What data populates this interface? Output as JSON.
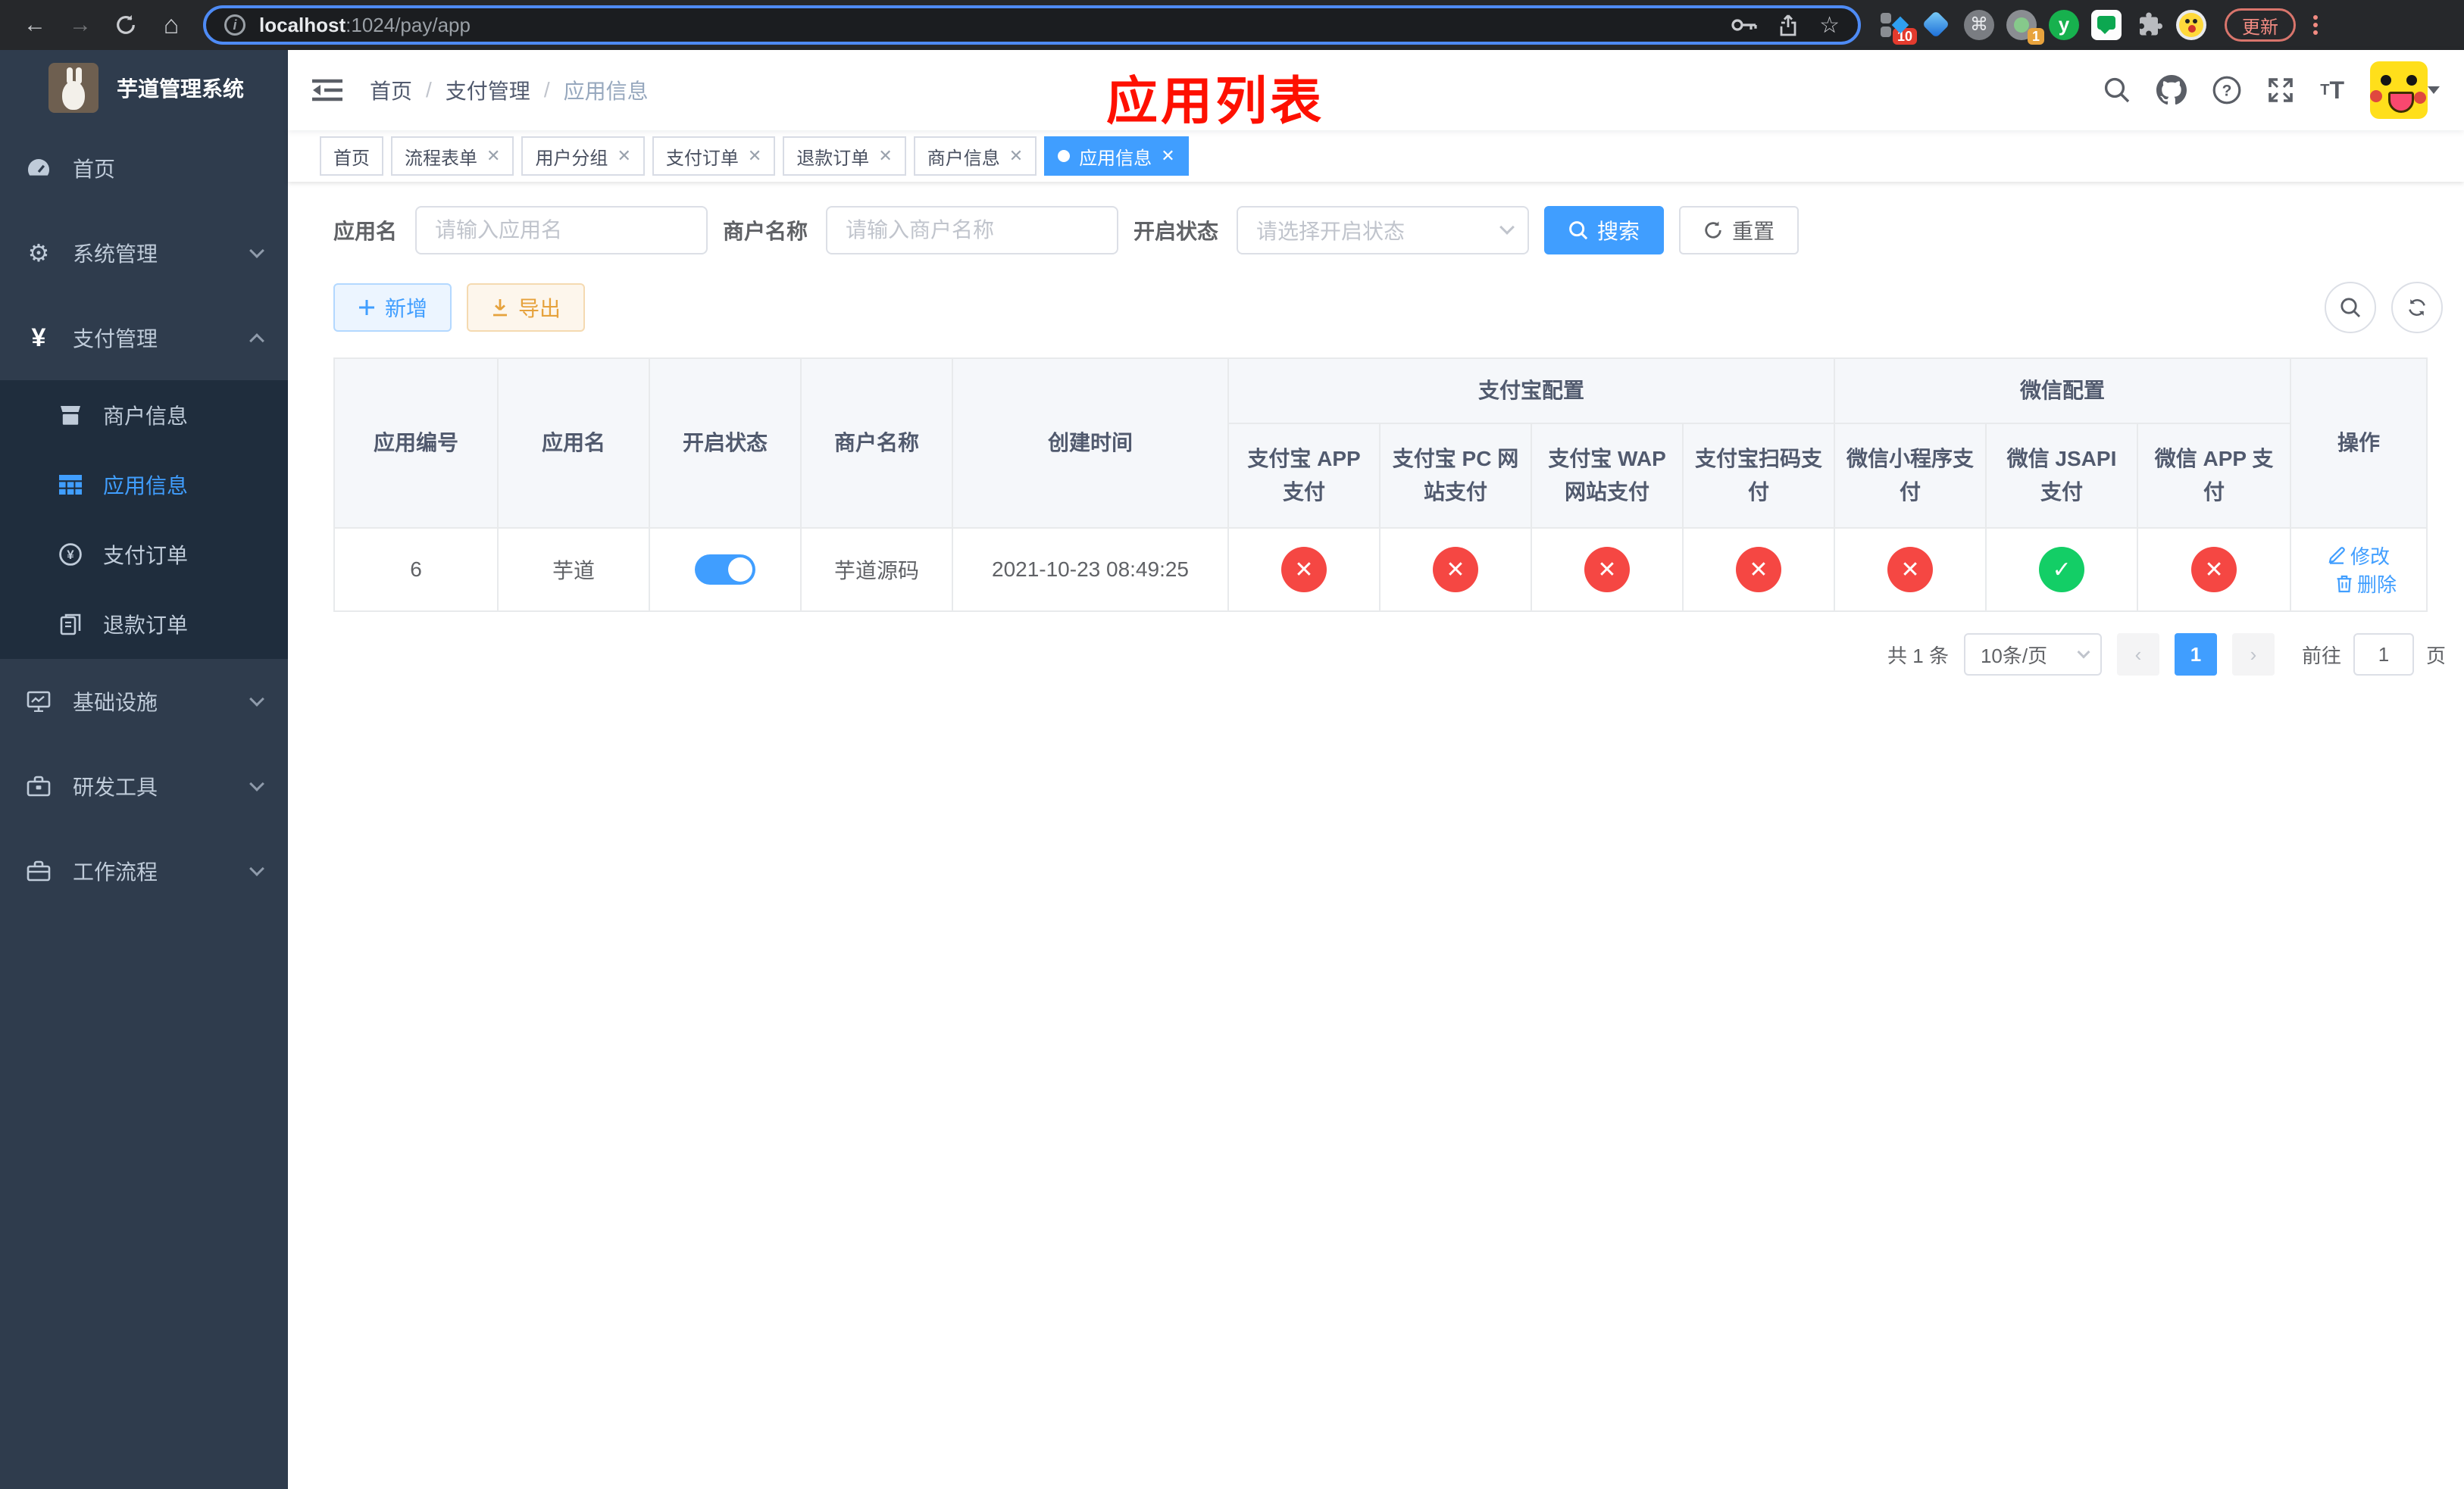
{
  "browser": {
    "url_host": "localhost",
    "url_rest": ":1024/pay/app",
    "update_label": "更新",
    "ext_badge_1": "10",
    "ext_badge_2": "1",
    "cmd_glyph": "⌘",
    "y_glyph": "y"
  },
  "sidebar": {
    "title": "芋道管理系统",
    "items": [
      {
        "label": "首页"
      },
      {
        "label": "系统管理"
      },
      {
        "label": "支付管理"
      },
      {
        "label": "基础设施"
      },
      {
        "label": "研发工具"
      },
      {
        "label": "工作流程"
      }
    ],
    "sub_items": [
      {
        "label": "商户信息"
      },
      {
        "label": "应用信息"
      },
      {
        "label": "支付订单"
      },
      {
        "label": "退款订单"
      }
    ]
  },
  "navbar": {
    "breadcrumb": [
      "首页",
      "支付管理",
      "应用信息"
    ],
    "annotation": "应用列表"
  },
  "tags": [
    {
      "label": "首页"
    },
    {
      "label": "流程表单"
    },
    {
      "label": "用户分组"
    },
    {
      "label": "支付订单"
    },
    {
      "label": "退款订单"
    },
    {
      "label": "商户信息"
    },
    {
      "label": "应用信息"
    }
  ],
  "filters": {
    "app_name_label": "应用名",
    "app_name_placeholder": "请输入应用名",
    "merchant_label": "商户名称",
    "merchant_placeholder": "请输入商户名称",
    "status_label": "开启状态",
    "status_placeholder": "请选择开启状态",
    "search_label": "搜索",
    "reset_label": "重置"
  },
  "toolbar": {
    "add_label": "新增",
    "export_label": "导出"
  },
  "table": {
    "groups": {
      "alipay": "支付宝配置",
      "wechat": "微信配置"
    },
    "columns": {
      "app_id": "应用编号",
      "app_name": "应用名",
      "status": "开启状态",
      "merchant": "商户名称",
      "created": "创建时间",
      "alipay_app": "支付宝 APP 支付",
      "alipay_pc": "支付宝 PC 网站支付",
      "alipay_wap": "支付宝 WAP 网站支付",
      "alipay_qr": "支付宝扫码支付",
      "wx_lite": "微信小程序支付",
      "wx_jsapi": "微信 JSAPI 支付",
      "wx_app": "微信 APP 支付",
      "actions": "操作"
    },
    "row": {
      "app_id": "6",
      "app_name": "芋道",
      "status_on": true,
      "merchant": "芋道源码",
      "created": "2021-10-23 08:49:25",
      "channels": [
        false,
        false,
        false,
        false,
        false,
        true,
        false
      ],
      "edit_label": "修改",
      "delete_label": "删除"
    }
  },
  "pagination": {
    "total": "共 1 条",
    "page_size": "10条/页",
    "current_page": "1",
    "goto_label": "前往",
    "goto_value": "1",
    "unit_label": "页"
  },
  "icons": {
    "check": "✓",
    "cross": "✕"
  },
  "colors": {
    "primary": "#409eff",
    "success": "#13ce66",
    "danger": "#f54743",
    "warning": "#e6a23c"
  }
}
